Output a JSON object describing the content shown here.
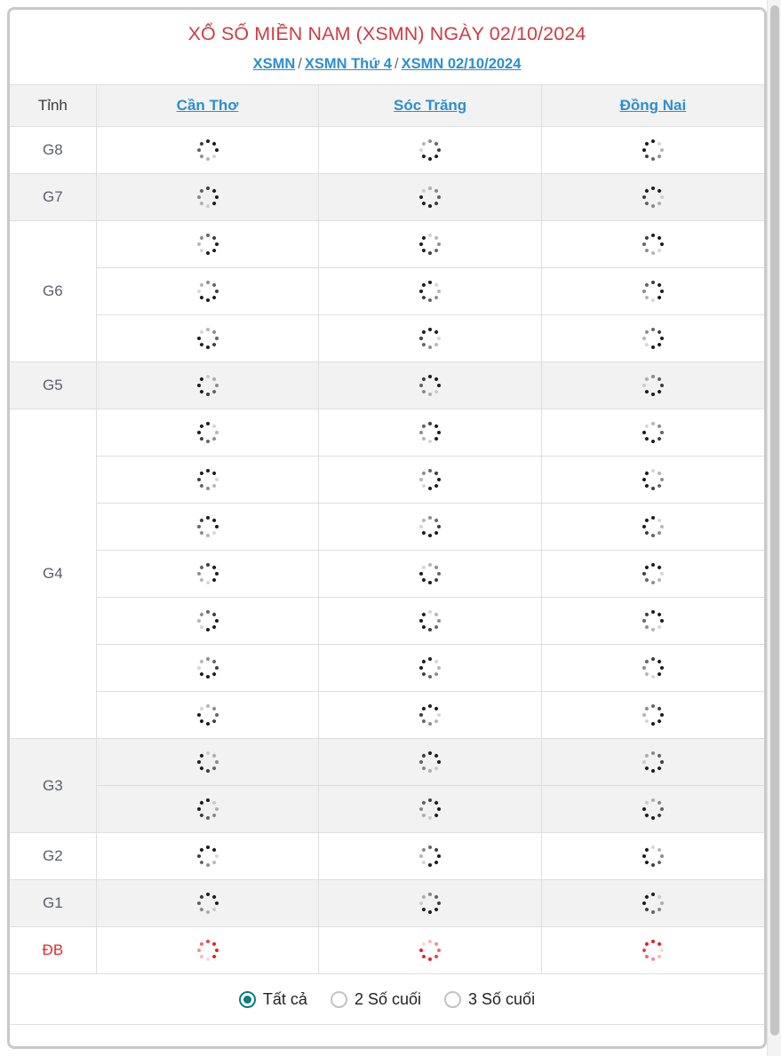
{
  "header": {
    "title": "XỔ SỐ MIỀN NAM (XSMN) NGÀY 02/10/2024",
    "title_color": "#cf3b46",
    "breadcrumb": [
      {
        "label": "XSMN",
        "is_link": true
      },
      {
        "label": "/",
        "is_link": false
      },
      {
        "label": "XSMN Thứ 4",
        "is_link": true
      },
      {
        "label": "/",
        "is_link": false
      },
      {
        "label": "XSMN 02/10/2024",
        "is_link": true
      }
    ],
    "link_color": "#2b8fd0"
  },
  "table": {
    "columns": [
      {
        "key": "prize",
        "label": "Tỉnh",
        "is_link": false
      },
      {
        "key": "cantho",
        "label": "Cần Thơ",
        "is_link": true
      },
      {
        "key": "soctrang",
        "label": "Sóc Trăng",
        "is_link": true
      },
      {
        "key": "dongnai",
        "label": "Đồng Nai",
        "is_link": true
      }
    ],
    "rows": [
      {
        "prize": "G8",
        "count": 1,
        "shaded": false,
        "highlight": false
      },
      {
        "prize": "G7",
        "count": 1,
        "shaded": true,
        "highlight": false
      },
      {
        "prize": "G6",
        "count": 3,
        "shaded": false,
        "highlight": false
      },
      {
        "prize": "G5",
        "count": 1,
        "shaded": true,
        "highlight": false
      },
      {
        "prize": "G4",
        "count": 7,
        "shaded": false,
        "highlight": false
      },
      {
        "prize": "G3",
        "count": 2,
        "shaded": true,
        "highlight": false
      },
      {
        "prize": "G2",
        "count": 1,
        "shaded": false,
        "highlight": false
      },
      {
        "prize": "G1",
        "count": 1,
        "shaded": true,
        "highlight": false
      },
      {
        "prize": "ĐB",
        "count": 1,
        "shaded": false,
        "highlight": true
      }
    ],
    "cell_state": "loading",
    "spinner_icon": "loading-spinner-icon",
    "spinner_color": "#1d1d1d",
    "spinner_color_highlight": "#e8202a",
    "highlight_color": "#e8262d"
  },
  "filter": {
    "options": [
      {
        "label": "Tất cả",
        "selected": true
      },
      {
        "label": "2 Số cuối",
        "selected": false
      },
      {
        "label": "3 Số cuối",
        "selected": false
      }
    ],
    "accent_color": "#0d7d7d"
  },
  "scrollbar": {
    "orientation": "vertical",
    "position": "right"
  }
}
